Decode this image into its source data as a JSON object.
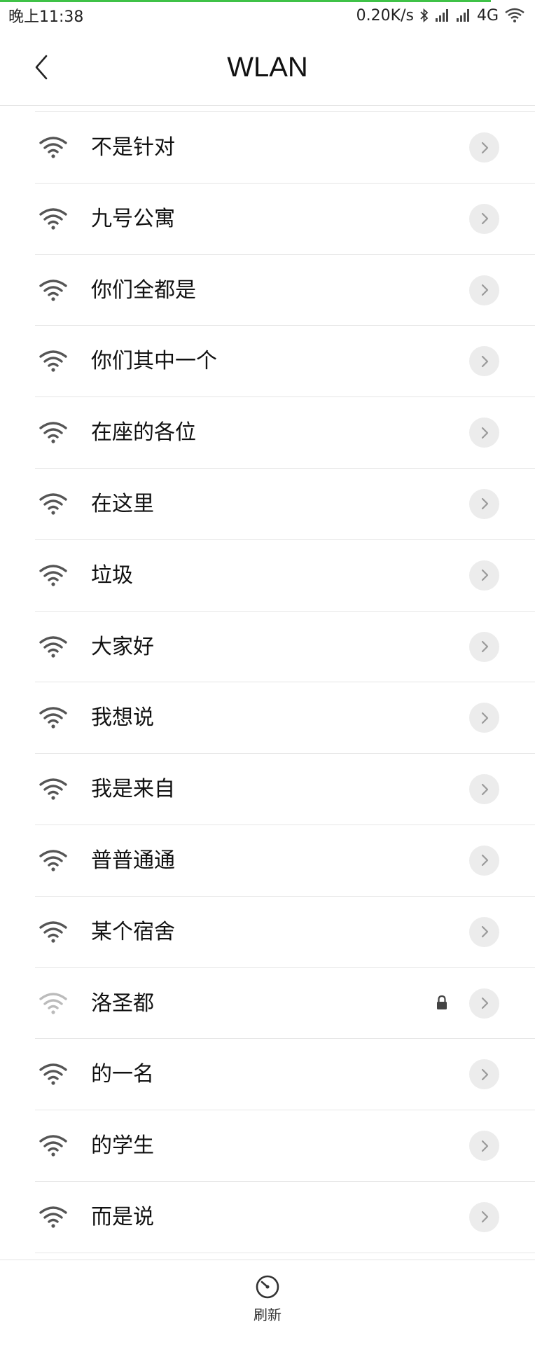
{
  "status_bar": {
    "time": "晚上11:38",
    "net_speed": "0.20K/s",
    "network_type": "4G",
    "icons": [
      "bluetooth-icon",
      "signal-icon",
      "signal-icon",
      "wifi-icon"
    ]
  },
  "nav": {
    "title": "WLAN",
    "back_icon": "chevron-left-icon"
  },
  "colors": {
    "progress": "#3fc247",
    "wifi_strong": "#555555",
    "wifi_weak": "#bbbbbb",
    "detail_bg": "#ececec"
  },
  "networks": [
    {
      "name": "不是针对",
      "signal": "strong",
      "locked": false
    },
    {
      "name": "九号公寓",
      "signal": "strong",
      "locked": false
    },
    {
      "name": "你们全都是",
      "signal": "strong",
      "locked": false
    },
    {
      "name": "你们其中一个",
      "signal": "strong",
      "locked": false
    },
    {
      "name": "在座的各位",
      "signal": "strong",
      "locked": false
    },
    {
      "name": "在这里",
      "signal": "strong",
      "locked": false
    },
    {
      "name": "垃圾",
      "signal": "strong",
      "locked": false
    },
    {
      "name": "大家好",
      "signal": "strong",
      "locked": false
    },
    {
      "name": "我想说",
      "signal": "strong",
      "locked": false
    },
    {
      "name": "我是来自",
      "signal": "strong",
      "locked": false
    },
    {
      "name": "普普通通",
      "signal": "strong",
      "locked": false
    },
    {
      "name": "某个宿舍",
      "signal": "strong",
      "locked": false
    },
    {
      "name": "洛圣都",
      "signal": "weak",
      "locked": true
    },
    {
      "name": "的一名",
      "signal": "strong",
      "locked": false
    },
    {
      "name": "的学生",
      "signal": "strong",
      "locked": false
    },
    {
      "name": "而是说",
      "signal": "strong",
      "locked": false
    }
  ],
  "bottom": {
    "refresh_label": "刷新",
    "refresh_icon": "refresh-icon"
  }
}
